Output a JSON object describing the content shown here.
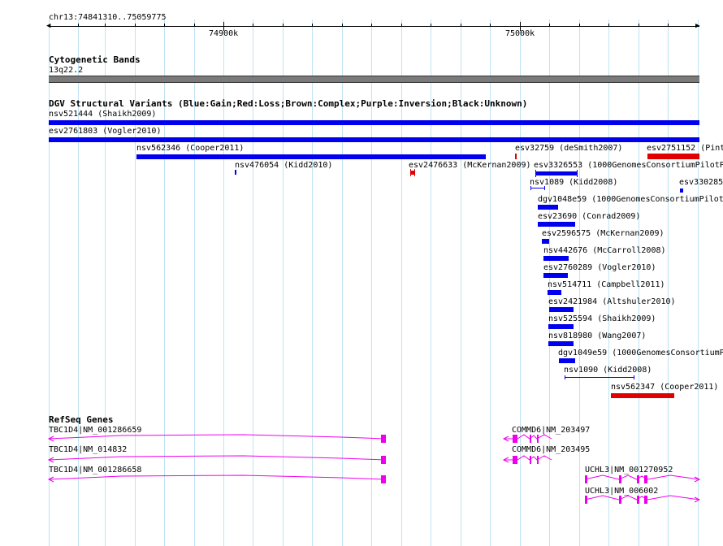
{
  "ruler": {
    "location": "chr13:74841310..75059775",
    "tick_labels": [
      "74900k",
      "75000k"
    ]
  },
  "cytoband_track": {
    "title": "Cytogenetic Bands",
    "band_label": "13q22.2"
  },
  "dgv_track": {
    "title": "DGV Structural Variants (Blue:Gain;Red:Loss;Brown:Complex;Purple:Inversion;Black:Unknown)",
    "colors": {
      "gain": "#0000ee",
      "loss": "#e00000"
    },
    "features": [
      {
        "label": "nsv521444 (Shaikh2009)",
        "type": "gain"
      },
      {
        "label": "esv2761803 (Vogler2010)",
        "type": "gain"
      },
      {
        "label": "nsv562346 (Cooper2011)",
        "type": "gain"
      },
      {
        "label": "esv32759 (deSmith2007)",
        "type": "loss"
      },
      {
        "label": "esv2751152 (Pint",
        "type": "loss"
      },
      {
        "label": "nsv476054 (Kidd2010)",
        "type": "gain"
      },
      {
        "label": "esv2476633 (McKernan2009)",
        "type": "loss"
      },
      {
        "label": "esv3326553 (1000GenomesConsortiumPilotP",
        "type": "gain"
      },
      {
        "label": "nsv1089 (Kidd2008)",
        "type": "gain"
      },
      {
        "label": "esv330285",
        "type": "gain"
      },
      {
        "label": "dgv1048e59 (1000GenomesConsortiumPilotP",
        "type": "gain"
      },
      {
        "label": "esv23690 (Conrad2009)",
        "type": "gain"
      },
      {
        "label": "esv2596575 (McKernan2009)",
        "type": "gain"
      },
      {
        "label": "nsv442676 (McCarroll2008)",
        "type": "gain"
      },
      {
        "label": "esv2760289 (Vogler2010)",
        "type": "gain"
      },
      {
        "label": "nsv514711 (Campbell2011)",
        "type": "gain"
      },
      {
        "label": "esv2421984 (Altshuler2010)",
        "type": "gain"
      },
      {
        "label": "nsv525594 (Shaikh2009)",
        "type": "gain"
      },
      {
        "label": "nsv818980 (Wang2007)",
        "type": "gain"
      },
      {
        "label": "dgv1049e59 (1000GenomesConsortiumP",
        "type": "gain"
      },
      {
        "label": "nsv1090 (Kidd2008)",
        "type": "gain"
      },
      {
        "label": "nsv562347 (Cooper2011)",
        "type": "loss"
      }
    ]
  },
  "refseq_track": {
    "title": "RefSeq Genes",
    "color": "#ee00ee",
    "genes": [
      {
        "label": "TBC1D4|NM_001286659",
        "strand": "-"
      },
      {
        "label": "TBC1D4|NM_014832",
        "strand": "-"
      },
      {
        "label": "TBC1D4|NM_001286658",
        "strand": "-"
      },
      {
        "label": "COMMD6|NM_203497",
        "strand": "-"
      },
      {
        "label": "COMMD6|NM_203495",
        "strand": "-"
      },
      {
        "label": "UCHL3|NM_001270952",
        "strand": "+"
      },
      {
        "label": "UCHL3|NM_006002",
        "strand": "+"
      }
    ]
  }
}
